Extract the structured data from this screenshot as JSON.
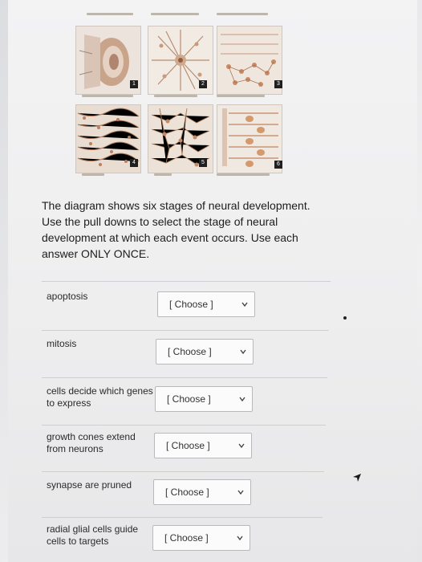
{
  "prompt": {
    "text": "The diagram shows six stages of neural development. Use the pull downs to select the stage of neural development at which each event occurs. Use each answer ONLY ONCE."
  },
  "figure": {
    "panel_numbers": [
      "1",
      "2",
      "3",
      "4",
      "5",
      "6"
    ]
  },
  "questions": [
    {
      "label": "apoptosis",
      "select_value": "[ Choose ]"
    },
    {
      "label": "mitosis",
      "select_value": "[ Choose ]"
    },
    {
      "label": "cells decide which genes to express",
      "select_value": "[ Choose ]"
    },
    {
      "label": "growth cones extend from neurons",
      "select_value": "[ Choose ]"
    },
    {
      "label": "synapse are pruned",
      "select_value": "[ Choose ]"
    },
    {
      "label": "radial glial cells guide cells to targets",
      "select_value": "[ Choose ]"
    }
  ],
  "colors": {
    "panel_bg": "#efe7df",
    "cell": "#c89b7a",
    "fiber": "#b07a56",
    "badge": "#1f1f1f"
  }
}
